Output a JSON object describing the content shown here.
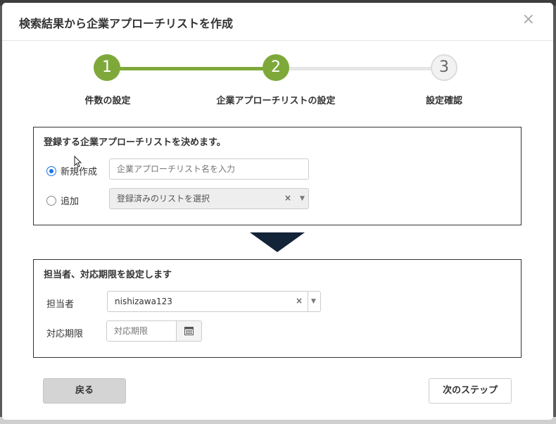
{
  "modal": {
    "title": "検索結果から企業アプローチリストを作成",
    "close": "×"
  },
  "stepper": {
    "steps": [
      {
        "number": "1",
        "label": "件数の設定",
        "state": "done"
      },
      {
        "number": "2",
        "label": "企業アプローチリストの設定",
        "state": "current"
      },
      {
        "number": "3",
        "label": "設定確認",
        "state": "pending"
      }
    ],
    "active_color": "#7ea93a",
    "inactive_color": "#e6e6e6"
  },
  "list_panel": {
    "title": "登録する企業アプローチリストを決めます。",
    "new_option": {
      "label": "新規作成",
      "checked": true,
      "placeholder": "企業アプローチリスト名を入力",
      "value": ""
    },
    "add_option": {
      "label": "追加",
      "checked": false,
      "select_value": "登録済みのリストを選択",
      "clear": "×",
      "arrow": "▼"
    }
  },
  "assign_panel": {
    "title": "担当者、対応期限を設定します",
    "owner": {
      "label": "担当者",
      "value": "nishizawa123",
      "clear": "×",
      "arrow": "▼"
    },
    "deadline": {
      "label": "対応期限",
      "placeholder": "対応期限",
      "icon": "calendar-icon"
    }
  },
  "footer": {
    "back_label": "戻る",
    "next_label": "次のステップ"
  }
}
